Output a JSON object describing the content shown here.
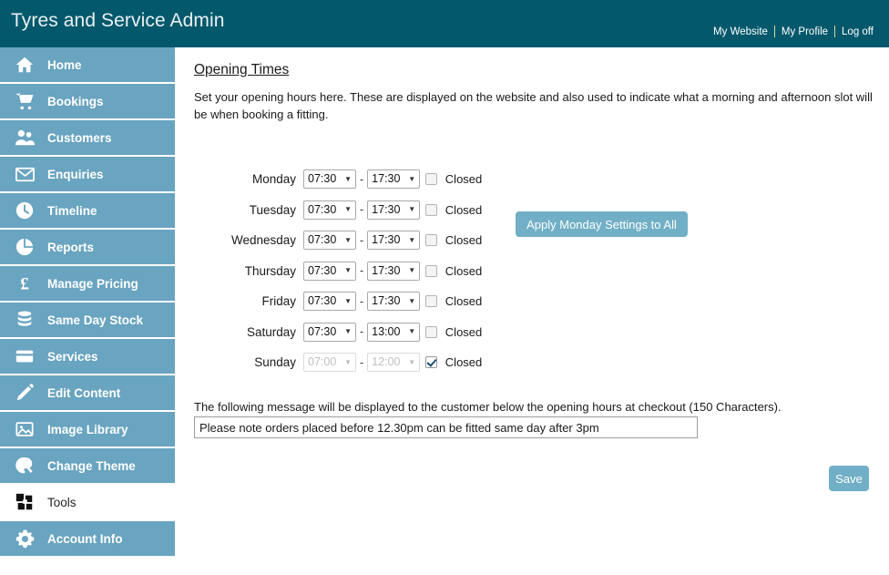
{
  "header": {
    "title": "Tyres and Service Admin",
    "links": [
      {
        "label": "My Website",
        "name": "my-website-link"
      },
      {
        "label": "My Profile",
        "name": "my-profile-link"
      },
      {
        "label": "Log off",
        "name": "log-off-link"
      }
    ]
  },
  "sidebar": {
    "items": [
      {
        "label": "Home",
        "icon": "home-icon",
        "active": false
      },
      {
        "label": "Bookings",
        "icon": "cart-icon",
        "active": false
      },
      {
        "label": "Customers",
        "icon": "users-icon",
        "active": false
      },
      {
        "label": "Enquiries",
        "icon": "envelope-icon",
        "active": false
      },
      {
        "label": "Timeline",
        "icon": "clock-icon",
        "active": false
      },
      {
        "label": "Reports",
        "icon": "pie-chart-icon",
        "active": false
      },
      {
        "label": "Manage Pricing",
        "icon": "pound-icon",
        "active": false
      },
      {
        "label": "Same Day Stock",
        "icon": "database-icon",
        "active": false
      },
      {
        "label": "Services",
        "icon": "card-icon",
        "active": false
      },
      {
        "label": "Edit Content",
        "icon": "pencil-icon",
        "active": false
      },
      {
        "label": "Image Library",
        "icon": "image-icon",
        "active": false
      },
      {
        "label": "Change Theme",
        "icon": "paint-roller-icon",
        "active": false
      },
      {
        "label": "Tools",
        "icon": "puzzle-icon",
        "active": true
      },
      {
        "label": "Account Info",
        "icon": "gear-icon",
        "active": false
      }
    ]
  },
  "main": {
    "page_title": "Opening Times",
    "intro": "Set your opening hours here. These are displayed on the website and also used to indicate what a morning and afternoon slot will be when booking a fitting.",
    "closed_label": "Closed",
    "dash": "-",
    "apply_button": "Apply Monday Settings to All",
    "save_button": "Save",
    "message_label": "The following message will be displayed to the customer below the opening hours at checkout (150 Characters).",
    "message_value": "Please note orders placed before 12.30pm can be fitted same day after 3pm",
    "message_placeholder": "",
    "days": [
      {
        "day": "Monday",
        "open": "07:30",
        "close": "17:30",
        "closed": false
      },
      {
        "day": "Tuesday",
        "open": "07:30",
        "close": "17:30",
        "closed": false
      },
      {
        "day": "Wednesday",
        "open": "07:30",
        "close": "17:30",
        "closed": false
      },
      {
        "day": "Thursday",
        "open": "07:30",
        "close": "17:30",
        "closed": false
      },
      {
        "day": "Friday",
        "open": "07:30",
        "close": "17:30",
        "closed": false
      },
      {
        "day": "Saturday",
        "open": "07:30",
        "close": "13:00",
        "closed": false
      },
      {
        "day": "Sunday",
        "open": "07:00",
        "close": "12:00",
        "closed": true
      }
    ]
  },
  "colors": {
    "header_bg": "#04586b",
    "sidebar_bg": "#69a4c0",
    "button_bg": "#71afc6",
    "text": "#1a1a1a"
  }
}
